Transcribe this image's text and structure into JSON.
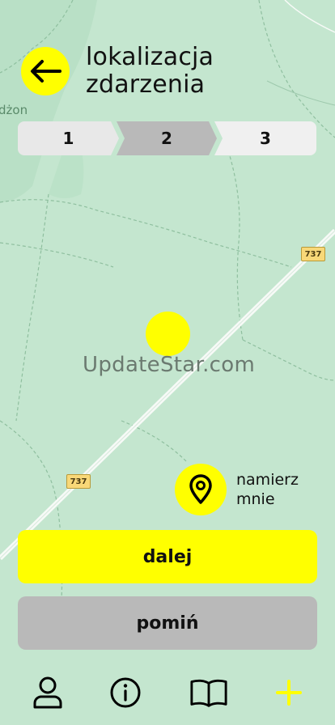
{
  "header": {
    "back_icon": "arrow-left-icon",
    "title": "lokalizacja zdarzenia"
  },
  "stepper": {
    "steps": [
      {
        "label": "1",
        "state": "done"
      },
      {
        "label": "2",
        "state": "active"
      },
      {
        "label": "3",
        "state": "pending"
      }
    ]
  },
  "map": {
    "place_label": "dżon",
    "road_number": "737",
    "watermark": "UpdateStar.com",
    "pin_color": "#ffff00"
  },
  "locate": {
    "icon": "location-pin-icon",
    "label": "namierz mnie"
  },
  "actions": {
    "next_label": "dalej",
    "skip_label": "pomiń"
  },
  "bottom_nav": {
    "items": [
      {
        "icon": "user-icon"
      },
      {
        "icon": "info-icon"
      },
      {
        "icon": "book-icon"
      },
      {
        "icon": "plus-icon",
        "active": true
      }
    ]
  },
  "colors": {
    "accent": "#ffff00",
    "map_bg": "#c4e6cf",
    "secondary": "#b9b9b9"
  }
}
